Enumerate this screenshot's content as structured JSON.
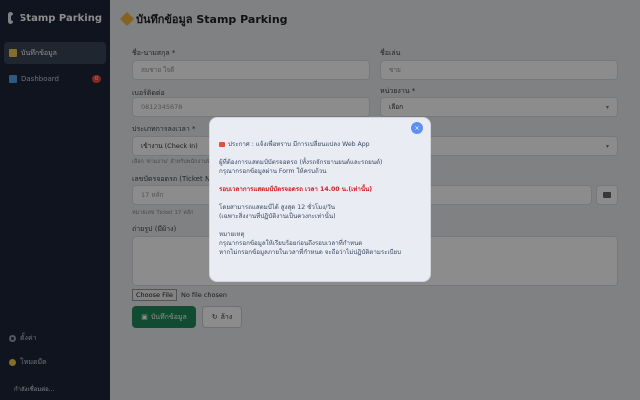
{
  "sidebar": {
    "brand": "Stamp Parking",
    "items": [
      {
        "label": "บันทึกข้อมูล"
      },
      {
        "label": "Dashboard",
        "badge": "0"
      }
    ],
    "settings_label": "ตั้งค่า",
    "night_label": "โหมดมืด",
    "status": "กำลังเชื่อมต่อ..."
  },
  "main": {
    "title": "บันทึกข้อมูล Stamp Parking",
    "fields": {
      "first_name_label": "ชื่อ-นามสกุล *",
      "first_name_placeholder": "สมชาย ใจดี",
      "nickname_label": "ชื่อเล่น",
      "nickname_placeholder": "ชาย",
      "phone_label": "เบอร์ติดต่อ",
      "phone_value": "0812345678",
      "department_label": "หน่วยงาน *",
      "department_value": "เลือก",
      "type_label": "ประเภทการลงเวลา *",
      "type_value": "เข้างาน (Check In)",
      "type_hint": "เลือก 'ตามงาน' สำหรับพนักงานที่ปฏิบัติงาน",
      "ticket_label": "เลขบัตรจอดรถ (Ticket No.)",
      "ticket_placeholder": "17 หลัก",
      "ticket_hint": "หมายเลข Ticket 17 หลัก",
      "photo_label": "ถ่ายรูป (มีผ้าง)",
      "file_button": "Choose File",
      "file_status": "No file chosen"
    },
    "submit_label": "บันทึกข้อมูล",
    "reset_label": "ล้าง"
  },
  "modal": {
    "lines": [
      {
        "text": "ประกาศ : แจ้งเพื่อทราบ มีการเปลี่ยนแปลง Web App",
        "style": "normal"
      },
      {
        "text": "",
        "style": "gap"
      },
      {
        "text": "ผู้ที่ต้องการแสตมป์บัตรจอดรถ (ทั้งรถจักรยานยนต์และรถยนต์)",
        "style": "normal"
      },
      {
        "text": "กรุณากรอกข้อมูลผ่าน Form ให้ครบถ้วน",
        "style": "normal"
      },
      {
        "text": "",
        "style": "gap"
      },
      {
        "text": "รอบเวลาการแสตมป์บัตรจอดรถ เวลา 14.00 น.(เท่านั้น)",
        "style": "red"
      },
      {
        "text": "",
        "style": "gap"
      },
      {
        "text": "โดยสามารถแสตมป์ได้ สูงสุด 12 ชั่วโมง/วัน",
        "style": "normal"
      },
      {
        "text": "(เฉพาะสิ่งงานที่ปฏิบัติงานเป็นควงกะเท่านั้น)",
        "style": "normal"
      },
      {
        "text": "",
        "style": "gap"
      },
      {
        "text": "หมายเหตุ",
        "style": "normal"
      },
      {
        "text": "กรุณากรอกข้อมูลให้เรียบร้อยก่อนถึงรอบเวลาที่กำหนด",
        "style": "normal"
      },
      {
        "text": "หากไม่กรอกข้อมูลภายในเวลาที่กำหนด จะถือว่าไม่ปฏิบัติตามระเบียบ",
        "style": "normal"
      }
    ],
    "close_label": "×"
  },
  "colors": {
    "sidebar_bg": "#1c2538",
    "primary_green": "#1f8b5c",
    "notice_red": "#d21f1f",
    "close_blue": "#5d8ff5"
  }
}
